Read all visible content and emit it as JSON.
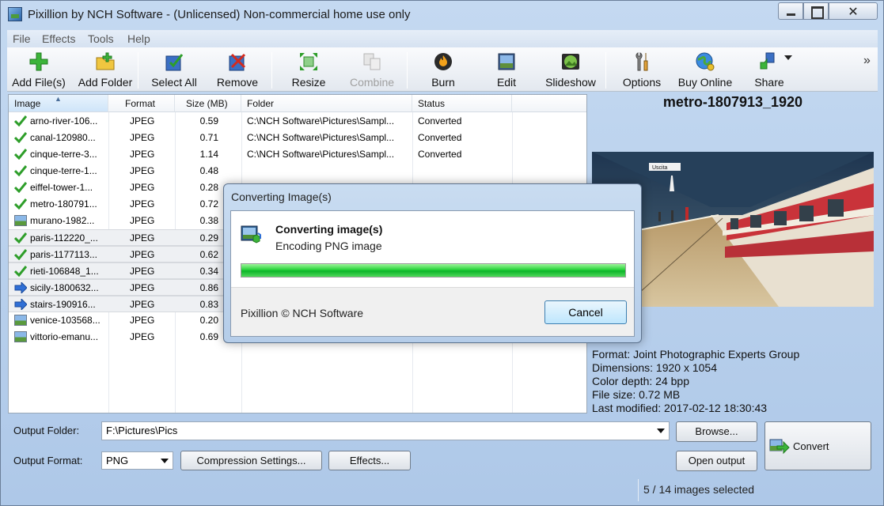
{
  "window": {
    "title": "Pixillion by NCH Software - (Unlicensed) Non-commercial home use only",
    "close_glyph": "✕"
  },
  "menu": [
    "File",
    "Effects",
    "Tools",
    "Help"
  ],
  "toolbar": {
    "buttons": [
      {
        "label": "Add File(s)",
        "icon": "add-plus-icon",
        "enabled": true
      },
      {
        "label": "Add Folder",
        "icon": "add-folder-icon",
        "enabled": true
      },
      {
        "label": "Select All",
        "icon": "select-all-icon",
        "enabled": true
      },
      {
        "label": "Remove",
        "icon": "remove-icon",
        "enabled": true
      },
      {
        "label": "Resize",
        "icon": "resize-icon",
        "enabled": true
      },
      {
        "label": "Combine",
        "icon": "combine-icon",
        "enabled": false
      },
      {
        "label": "Burn",
        "icon": "burn-icon",
        "enabled": true
      },
      {
        "label": "Edit",
        "icon": "edit-icon",
        "enabled": true
      },
      {
        "label": "Slideshow",
        "icon": "slideshow-icon",
        "enabled": true
      },
      {
        "label": "Options",
        "icon": "options-icon",
        "enabled": true
      },
      {
        "label": "Buy Online",
        "icon": "buy-online-icon",
        "enabled": true
      },
      {
        "label": "Share",
        "icon": "share-icon",
        "enabled": true
      }
    ],
    "more": "»"
  },
  "filelist": {
    "columns": [
      "Image",
      "Format",
      "Size (MB)",
      "Folder",
      "Status"
    ],
    "rows": [
      {
        "name": "arno-river-106...",
        "format": "JPEG",
        "size": "0.59",
        "folder": "C:\\NCH Software\\Pictures\\Sampl...",
        "status": "Converted",
        "icon": "check",
        "selected": false
      },
      {
        "name": "canal-120980...",
        "format": "JPEG",
        "size": "0.71",
        "folder": "C:\\NCH Software\\Pictures\\Sampl...",
        "status": "Converted",
        "icon": "check",
        "selected": false
      },
      {
        "name": "cinque-terre-3...",
        "format": "JPEG",
        "size": "1.14",
        "folder": "C:\\NCH Software\\Pictures\\Sampl...",
        "status": "Converted",
        "icon": "check",
        "selected": false
      },
      {
        "name": "cinque-terre-1...",
        "format": "JPEG",
        "size": "0.48",
        "folder": "",
        "status": "",
        "icon": "check",
        "selected": false
      },
      {
        "name": "eiffel-tower-1...",
        "format": "JPEG",
        "size": "0.28",
        "folder": "",
        "status": "",
        "icon": "check",
        "selected": false
      },
      {
        "name": "metro-180791...",
        "format": "JPEG",
        "size": "0.72",
        "folder": "",
        "status": "",
        "icon": "check",
        "selected": false
      },
      {
        "name": "murano-1982...",
        "format": "JPEG",
        "size": "0.38",
        "folder": "",
        "status": "",
        "icon": "image",
        "selected": false
      },
      {
        "name": "paris-112220_...",
        "format": "JPEG",
        "size": "0.29",
        "folder": "",
        "status": "",
        "icon": "check",
        "selected": true
      },
      {
        "name": "paris-1177113...",
        "format": "JPEG",
        "size": "0.62",
        "folder": "",
        "status": "",
        "icon": "check",
        "selected": true
      },
      {
        "name": "rieti-106848_1...",
        "format": "JPEG",
        "size": "0.34",
        "folder": "",
        "status": "",
        "icon": "check",
        "selected": true
      },
      {
        "name": "sicily-1800632...",
        "format": "JPEG",
        "size": "0.86",
        "folder": "",
        "status": "",
        "icon": "arrow",
        "selected": true
      },
      {
        "name": "stairs-190916...",
        "format": "JPEG",
        "size": "0.83",
        "folder": "",
        "status": "",
        "icon": "arrow",
        "selected": true
      },
      {
        "name": "venice-103568...",
        "format": "JPEG",
        "size": "0.20",
        "folder": "",
        "status": "",
        "icon": "image",
        "selected": false
      },
      {
        "name": "vittorio-emanu...",
        "format": "JPEG",
        "size": "0.69",
        "folder": "",
        "status": "",
        "icon": "image",
        "selected": false
      }
    ]
  },
  "preview": {
    "title": "metro-1807913_1920",
    "format": "Format: Joint Photographic Experts Group",
    "dimensions": "Dimensions: 1920 x 1054",
    "color_depth": "Color depth: 24 bpp",
    "file_size": "File size: 0.72 MB",
    "last_modified": "Last modified: 2017-02-12 18:30:43",
    "sign_text": "Uscita"
  },
  "output": {
    "folder_label": "Output Folder:",
    "folder_value": "F:\\Pictures\\Pics",
    "browse": "Browse...",
    "format_label": "Output Format:",
    "format_value": "PNG",
    "compression": "Compression Settings...",
    "effects": "Effects...",
    "open_output": "Open output",
    "convert": "Convert"
  },
  "status": {
    "selection": "5 / 14 images selected"
  },
  "dialog": {
    "title": "Converting Image(s)",
    "heading": "Converting image(s)",
    "subtext": "Encoding PNG image",
    "progress": 1.0,
    "footer": "Pixillion © NCH Software",
    "cancel": "Cancel"
  },
  "colors": {
    "check_green": "#2e9e2a",
    "arrow_blue": "#2f6fd6",
    "progress_green": "#1fc631"
  }
}
